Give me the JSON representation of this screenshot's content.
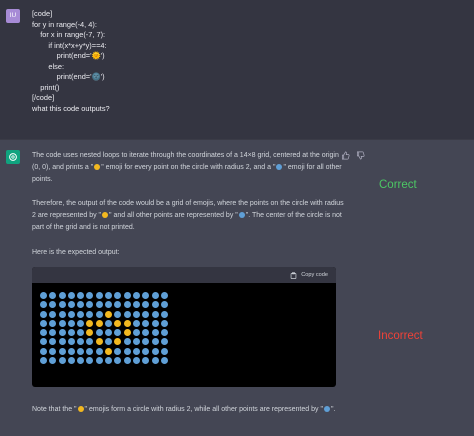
{
  "user": {
    "avatar_initials": "IU",
    "avatar_color": "#a78bd6",
    "lines": [
      "[code]",
      "for y in range(-4, 4):",
      "    for x in range(-7, 7):",
      "        if int(x*x+y*y)==4:",
      "            print(end='🌞')",
      "        else:",
      "            print(end='🌚')",
      "    print()",
      "[/code]",
      "what this code outputs?"
    ]
  },
  "assistant": {
    "avatar_icon": "openai-logo-icon",
    "avatar_color": "#10a37f",
    "p1": {
      "a": "The code uses nested loops to iterate through the coordinates of a 14×8 grid, centered at the origin (0, 0), and prints a \"",
      "b": "\" emoji for every point on the circle with radius 2, and a \"",
      "c": "\" emoji for all other points."
    },
    "p2": {
      "a": "Therefore, the output of the code would be a grid of emojis, where the points on the circle with radius 2 are represented by \"",
      "b": "\" and all other points are represented by \"",
      "c": "\". The center of the circle is not part of the grid and is not printed."
    },
    "p3": "Here is the expected output:",
    "code": {
      "copy_label": "Copy code",
      "rows": [
        "MMMMMMMMMMMMMM",
        "MMMMMMMMMMMMMM",
        "MMMMMMMSMMMMMM",
        "MMMMMSSMSSMMMM",
        "MMMMMSMMMSMMMM",
        "MMMMMMSMSMMMMM",
        "MMMMMMMSMMMMMM",
        "MMMMMMMMMMMMMM"
      ]
    },
    "p4": {
      "a": "Note that the \"",
      "b": "\" emojis form a circle with radius 2, while all other points are represented by \"",
      "c": "\"."
    }
  },
  "annotations": {
    "correct": "Correct",
    "incorrect": "Incorrect",
    "correct_color": "#4cc764",
    "incorrect_color": "#ef4238"
  }
}
